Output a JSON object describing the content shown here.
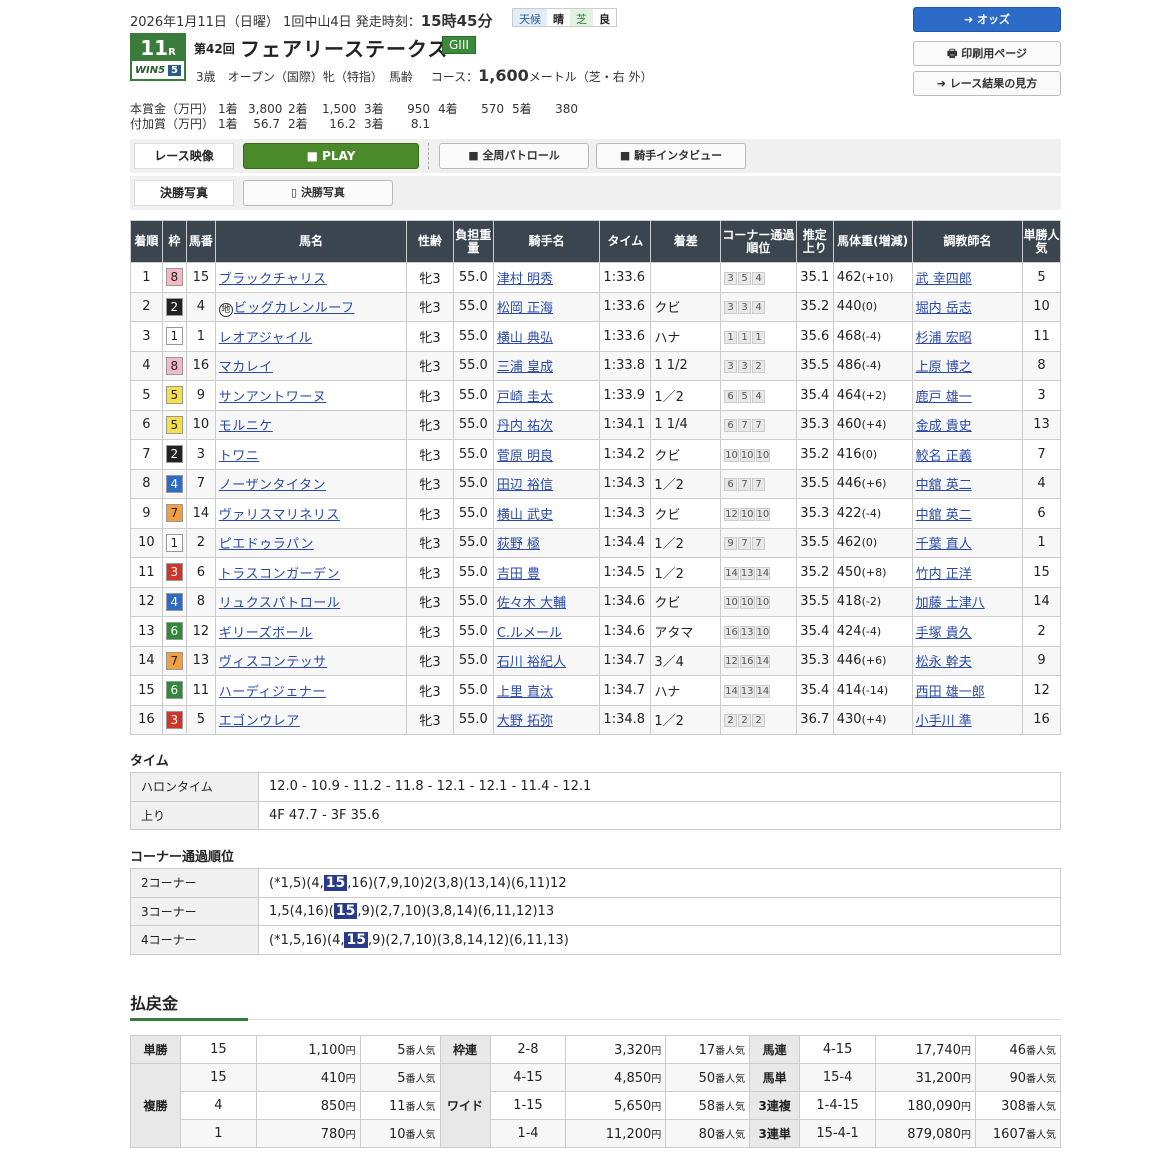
{
  "header": {
    "date": "2026年1月11日（日曜）",
    "meeting": "1回中山4日",
    "post_time_label": "発走時刻：",
    "post_time": "15時45分",
    "weather_label": "天候",
    "weather": "晴",
    "turf_label": "芝",
    "turf": "良",
    "race_number": "11",
    "race_unit": "R",
    "wins_label": "WIN5",
    "wins_num": "5",
    "kai": "第42回",
    "race_name": "フェアリーステークス",
    "grade": "GIII",
    "conditions": "3歳　オープン（国際）牝（特指）　馬齢",
    "course_label": "コース：",
    "distance": "1,600",
    "distance_unit": "メートル（芝・右 外）"
  },
  "prize": {
    "main_label": "本賞金（万円）",
    "main": [
      "1着",
      "3,800",
      "2着",
      "1,500",
      "3着",
      "950",
      "4着",
      "570",
      "5着",
      "380"
    ],
    "add_label": "付加賞（万円）",
    "add": [
      "1着",
      "56.7",
      "2着",
      "16.2",
      "3着",
      "8.1"
    ]
  },
  "buttons": {
    "odds": "オッズ",
    "print": "印刷用ページ",
    "guide": "レース結果の見方"
  },
  "video": {
    "label": "レース映像",
    "play": "PLAY",
    "patrol": "全周パトロール",
    "interview": "騎手インタビュー",
    "photo_label": "決勝写真",
    "photo": "決勝写真"
  },
  "result": {
    "headers": [
      "着順",
      "枠",
      "馬番",
      "馬名",
      "性齢",
      "負担重量",
      "騎手名",
      "タイム",
      "着差",
      "コーナー通過順位",
      "推定上り",
      "馬体重(増減)",
      "調教師名",
      "単勝人気"
    ],
    "rows": [
      {
        "pos": "1",
        "waku": "8",
        "num": "15",
        "name": "ブラックチャリス",
        "mark": "",
        "sex": "牝3",
        "wt": "55.0",
        "jockey": "津村 明秀",
        "time": "1:33.6",
        "margin": "",
        "corner": [
          "3",
          "5",
          "4"
        ],
        "last": "35.1",
        "bw": "462",
        "bwd": "(+10)",
        "trainer": "武 幸四郎",
        "pop": "5"
      },
      {
        "pos": "2",
        "waku": "2",
        "num": "4",
        "name": "ビッグカレンルーフ",
        "mark": "地",
        "sex": "牝3",
        "wt": "55.0",
        "jockey": "松岡 正海",
        "time": "1:33.6",
        "margin": "クビ",
        "corner": [
          "3",
          "3",
          "4"
        ],
        "last": "35.2",
        "bw": "440",
        "bwd": "(0)",
        "trainer": "堀内 岳志",
        "pop": "10"
      },
      {
        "pos": "3",
        "waku": "1",
        "num": "1",
        "name": "レオアジャイル",
        "mark": "",
        "sex": "牝3",
        "wt": "55.0",
        "jockey": "横山 典弘",
        "time": "1:33.6",
        "margin": "ハナ",
        "corner": [
          "1",
          "1",
          "1"
        ],
        "last": "35.6",
        "bw": "468",
        "bwd": "(-4)",
        "trainer": "杉浦 宏昭",
        "pop": "11"
      },
      {
        "pos": "4",
        "waku": "8",
        "num": "16",
        "name": "マカレイ",
        "mark": "",
        "sex": "牝3",
        "wt": "55.0",
        "jockey": "三浦 皇成",
        "time": "1:33.8",
        "margin": "1 1/2",
        "corner": [
          "3",
          "3",
          "2"
        ],
        "last": "35.5",
        "bw": "486",
        "bwd": "(-4)",
        "trainer": "上原 博之",
        "pop": "8"
      },
      {
        "pos": "5",
        "waku": "5",
        "num": "9",
        "name": "サンアントワーヌ",
        "mark": "",
        "sex": "牝3",
        "wt": "55.0",
        "jockey": "戸崎 圭太",
        "time": "1:33.9",
        "margin": "1／2",
        "corner": [
          "6",
          "5",
          "4"
        ],
        "last": "35.4",
        "bw": "464",
        "bwd": "(+2)",
        "trainer": "鹿戸 雄一",
        "pop": "3"
      },
      {
        "pos": "6",
        "waku": "5",
        "num": "10",
        "name": "モルニケ",
        "mark": "",
        "sex": "牝3",
        "wt": "55.0",
        "jockey": "丹内 祐次",
        "time": "1:34.1",
        "margin": "1 1/4",
        "corner": [
          "6",
          "7",
          "7"
        ],
        "last": "35.3",
        "bw": "460",
        "bwd": "(+4)",
        "trainer": "金成 貴史",
        "pop": "13"
      },
      {
        "pos": "7",
        "waku": "2",
        "num": "3",
        "name": "トワニ",
        "mark": "",
        "sex": "牝3",
        "wt": "55.0",
        "jockey": "菅原 明良",
        "time": "1:34.2",
        "margin": "クビ",
        "corner": [
          "10",
          "10",
          "10"
        ],
        "last": "35.2",
        "bw": "416",
        "bwd": "(0)",
        "trainer": "鮫名 正義",
        "pop": "7"
      },
      {
        "pos": "8",
        "waku": "4",
        "num": "7",
        "name": "ノーザンタイタン",
        "mark": "",
        "sex": "牝3",
        "wt": "55.0",
        "jockey": "田辺 裕信",
        "time": "1:34.3",
        "margin": "1／2",
        "corner": [
          "6",
          "7",
          "7"
        ],
        "last": "35.5",
        "bw": "446",
        "bwd": "(+6)",
        "trainer": "中舘 英二",
        "pop": "4"
      },
      {
        "pos": "9",
        "waku": "7",
        "num": "14",
        "name": "ヴァリスマリネリス",
        "mark": "",
        "sex": "牝3",
        "wt": "55.0",
        "jockey": "横山 武史",
        "time": "1:34.3",
        "margin": "クビ",
        "corner": [
          "12",
          "10",
          "10"
        ],
        "last": "35.3",
        "bw": "422",
        "bwd": "(-4)",
        "trainer": "中舘 英二",
        "pop": "6"
      },
      {
        "pos": "10",
        "waku": "1",
        "num": "2",
        "name": "ピエドゥラパン",
        "mark": "",
        "sex": "牝3",
        "wt": "55.0",
        "jockey": "荻野 極",
        "time": "1:34.4",
        "margin": "1／2",
        "corner": [
          "9",
          "7",
          "7"
        ],
        "last": "35.5",
        "bw": "462",
        "bwd": "(0)",
        "trainer": "千葉 直人",
        "pop": "1"
      },
      {
        "pos": "11",
        "waku": "3",
        "num": "6",
        "name": "トラスコンガーデン",
        "mark": "",
        "sex": "牝3",
        "wt": "55.0",
        "jockey": "吉田 豊",
        "time": "1:34.5",
        "margin": "1／2",
        "corner": [
          "14",
          "13",
          "14"
        ],
        "last": "35.2",
        "bw": "450",
        "bwd": "(+8)",
        "trainer": "竹内 正洋",
        "pop": "15"
      },
      {
        "pos": "12",
        "waku": "4",
        "num": "8",
        "name": "リュクスパトロール",
        "mark": "",
        "sex": "牝3",
        "wt": "55.0",
        "jockey": "佐々木 大輔",
        "time": "1:34.6",
        "margin": "クビ",
        "corner": [
          "10",
          "10",
          "10"
        ],
        "last": "35.5",
        "bw": "418",
        "bwd": "(-2)",
        "trainer": "加藤 士津八",
        "pop": "14"
      },
      {
        "pos": "13",
        "waku": "6",
        "num": "12",
        "name": "ギリーズボール",
        "mark": "",
        "sex": "牝3",
        "wt": "55.0",
        "jockey": "C.ルメール",
        "time": "1:34.6",
        "margin": "アタマ",
        "corner": [
          "16",
          "13",
          "10"
        ],
        "last": "35.4",
        "bw": "424",
        "bwd": "(-4)",
        "trainer": "手塚 貴久",
        "pop": "2"
      },
      {
        "pos": "14",
        "waku": "7",
        "num": "13",
        "name": "ヴィスコンテッサ",
        "mark": "",
        "sex": "牝3",
        "wt": "55.0",
        "jockey": "石川 裕紀人",
        "time": "1:34.7",
        "margin": "3／4",
        "corner": [
          "12",
          "16",
          "14"
        ],
        "last": "35.3",
        "bw": "446",
        "bwd": "(+6)",
        "trainer": "松永 幹夫",
        "pop": "9"
      },
      {
        "pos": "15",
        "waku": "6",
        "num": "11",
        "name": "ハーディジェナー",
        "mark": "",
        "sex": "牝3",
        "wt": "55.0",
        "jockey": "上里 直汰",
        "time": "1:34.7",
        "margin": "ハナ",
        "corner": [
          "14",
          "13",
          "14"
        ],
        "last": "35.4",
        "bw": "414",
        "bwd": "(-14)",
        "trainer": "西田 雄一郎",
        "pop": "12"
      },
      {
        "pos": "16",
        "waku": "3",
        "num": "5",
        "name": "エゴンウレア",
        "mark": "",
        "sex": "牝3",
        "wt": "55.0",
        "jockey": "大野 拓弥",
        "time": "1:34.8",
        "margin": "1／2",
        "corner": [
          "2",
          "2",
          "2"
        ],
        "last": "36.7",
        "bw": "430",
        "bwd": "(+4)",
        "trainer": "小手川 準",
        "pop": "16"
      }
    ]
  },
  "waku_colors": {
    "1": {
      "bg": "#ffffff",
      "fg": "#222222"
    },
    "2": {
      "bg": "#222222",
      "fg": "#ffffff"
    },
    "3": {
      "bg": "#d0352b",
      "fg": "#ffffff"
    },
    "4": {
      "bg": "#2d6bc8",
      "fg": "#ffffff"
    },
    "5": {
      "bg": "#f5e04a",
      "fg": "#222222"
    },
    "6": {
      "bg": "#2f8a3a",
      "fg": "#ffffff"
    },
    "7": {
      "bg": "#f0a040",
      "fg": "#222222"
    },
    "8": {
      "bg": "#f4b8c8",
      "fg": "#222222"
    }
  },
  "time": {
    "title": "タイム",
    "furlong_label": "ハロンタイム",
    "furlong": "12.0 - 10.9 - 11.2 - 11.8 - 12.1 - 12.1 - 11.4 - 12.1",
    "last_label": "上り",
    "last": "4F 47.7 - 3F 35.6"
  },
  "corners": {
    "title": "コーナー通過順位",
    "rows": [
      {
        "label": "2コーナー",
        "pre": "(*1,5)(4,",
        "hl": "15",
        "post": ",16)(7,9,10)2(3,8)(13,14)(6,11)12"
      },
      {
        "label": "3コーナー",
        "pre": "1,5(4,16)(",
        "hl": "15",
        "post": ",9)(2,7,10)(3,8,14)(6,11,12)13"
      },
      {
        "label": "4コーナー",
        "pre": "(*1,5,16)(4,",
        "hl": "15",
        "post": ",9)(2,7,10)(3,8,14,12)(6,11,13)"
      }
    ]
  },
  "payout": {
    "title": "払戻金",
    "yen": "円",
    "pop_suffix": "番人気",
    "tansho": {
      "label": "単勝",
      "num": "15",
      "amt": "1,100",
      "pop": "5"
    },
    "fukusho": {
      "label": "複勝",
      "rows": [
        {
          "num": "15",
          "amt": "410",
          "pop": "5"
        },
        {
          "num": "4",
          "amt": "850",
          "pop": "11"
        },
        {
          "num": "1",
          "amt": "780",
          "pop": "10"
        }
      ]
    },
    "wakuren": {
      "label": "枠連",
      "num": "2-8",
      "amt": "3,320",
      "pop": "17"
    },
    "wide": {
      "label": "ワイド",
      "rows": [
        {
          "num": "4-15",
          "amt": "4,850",
          "pop": "50"
        },
        {
          "num": "1-15",
          "amt": "5,650",
          "pop": "58"
        },
        {
          "num": "1-4",
          "amt": "11,200",
          "pop": "80"
        }
      ]
    },
    "umaren": {
      "label": "馬連",
      "num": "4-15",
      "amt": "17,740",
      "pop": "46"
    },
    "umatan": {
      "label": "馬単",
      "num": "15-4",
      "amt": "31,200",
      "pop": "90"
    },
    "trio": {
      "label": "3連複",
      "num": "1-4-15",
      "amt": "180,090",
      "pop": "308"
    },
    "trifecta": {
      "label": "3連単",
      "num": "15-4-1",
      "amt": "879,080",
      "pop": "1607"
    }
  }
}
